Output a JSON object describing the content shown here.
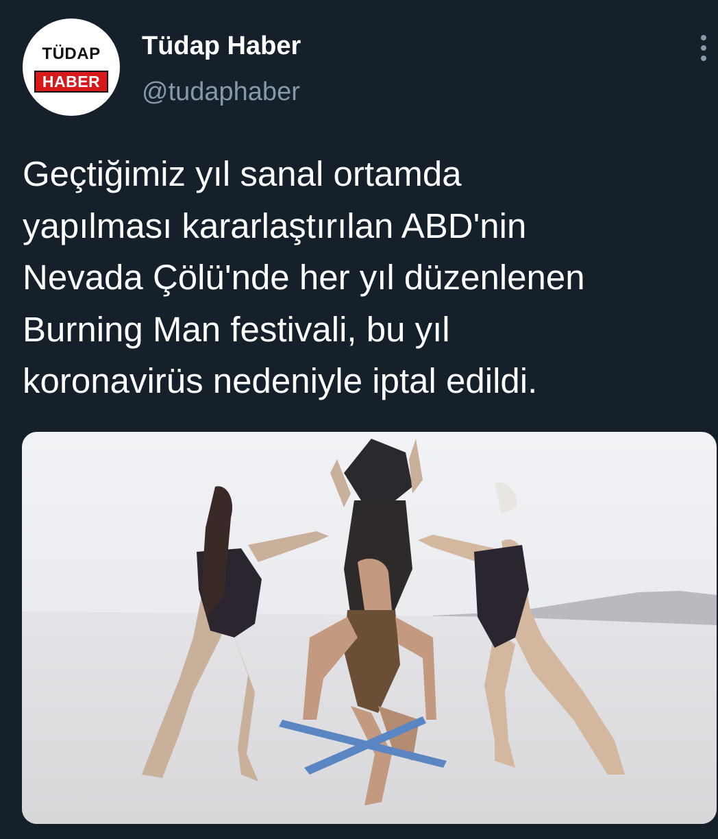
{
  "account": {
    "avatar_logo_top": "TÜDAP",
    "avatar_logo_bottom": "HABER",
    "display_name": "Tüdap Haber",
    "handle": "@tudaphaber"
  },
  "tweet": {
    "text_lines": [
      "Geçtiğimiz yıl sanal ortamda",
      "yapılması kararlaştırılan ABD'nin",
      "Nevada Çölü'nde her yıl düzenlenen",
      "Burning Man festivali, bu yıl",
      "koronavirüs nedeniyle iptal edildi."
    ]
  },
  "icons": {
    "more": "more-vertical-icon"
  },
  "colors": {
    "background": "#15202b",
    "text": "#ffffff",
    "secondary_text": "#8899a6",
    "logo_red": "#d7191c"
  }
}
